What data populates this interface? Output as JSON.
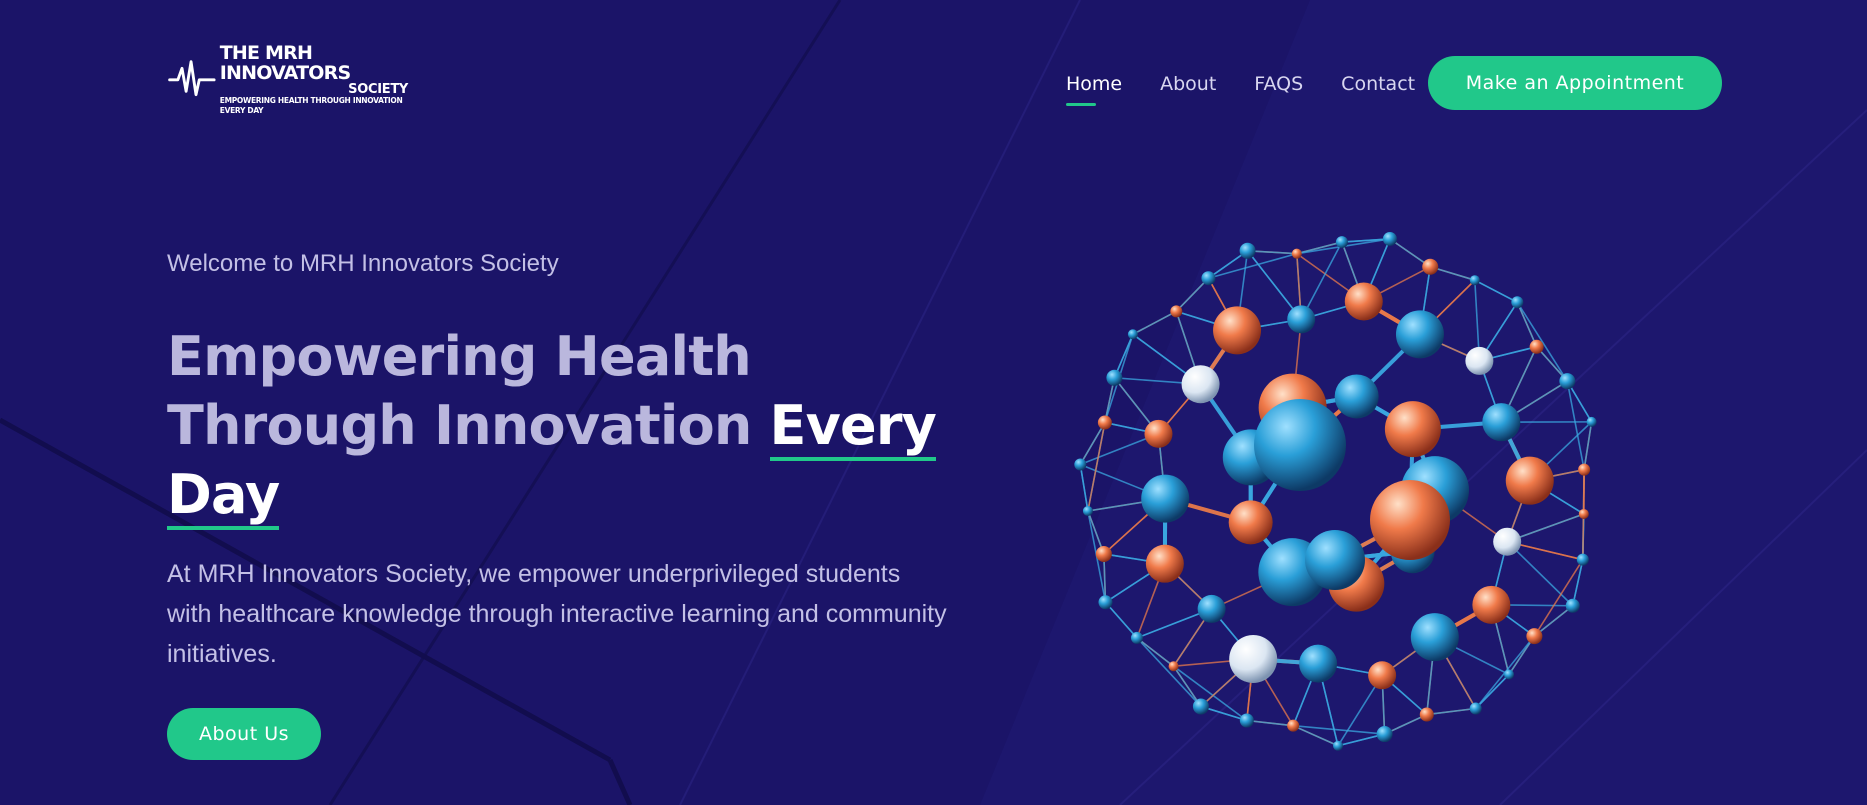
{
  "brand": {
    "title": "THE MRH INNOVATORS",
    "subtitle": "SOCIETY",
    "tagline": "EMPOWERING HEALTH THROUGH INNOVATION EVERY DAY"
  },
  "nav": {
    "items": [
      {
        "label": "Home",
        "active": true
      },
      {
        "label": "About",
        "active": false
      },
      {
        "label": "FAQS",
        "active": false
      },
      {
        "label": "Contact",
        "active": false
      }
    ],
    "cta_label": "Make an Appointment"
  },
  "hero": {
    "welcome": "Welcome to MRH Innovators Society",
    "headline_part1": "Empowering Health Through Innovation ",
    "headline_highlight1": "Every",
    "headline_highlight2": "Day",
    "description": "At MRH Innovators Society, we empower underprivileged students with healthcare knowledge through interactive learning and community initiatives.",
    "button_label": "About Us"
  },
  "colors": {
    "background": "#1b1468",
    "accent": "#21c88a",
    "molecule_blue": "#2a9fd8",
    "molecule_orange": "#f07a4a"
  },
  "icons": {
    "logo": "heartbeat-icon",
    "hero_image": "molecule-network-illustration"
  }
}
